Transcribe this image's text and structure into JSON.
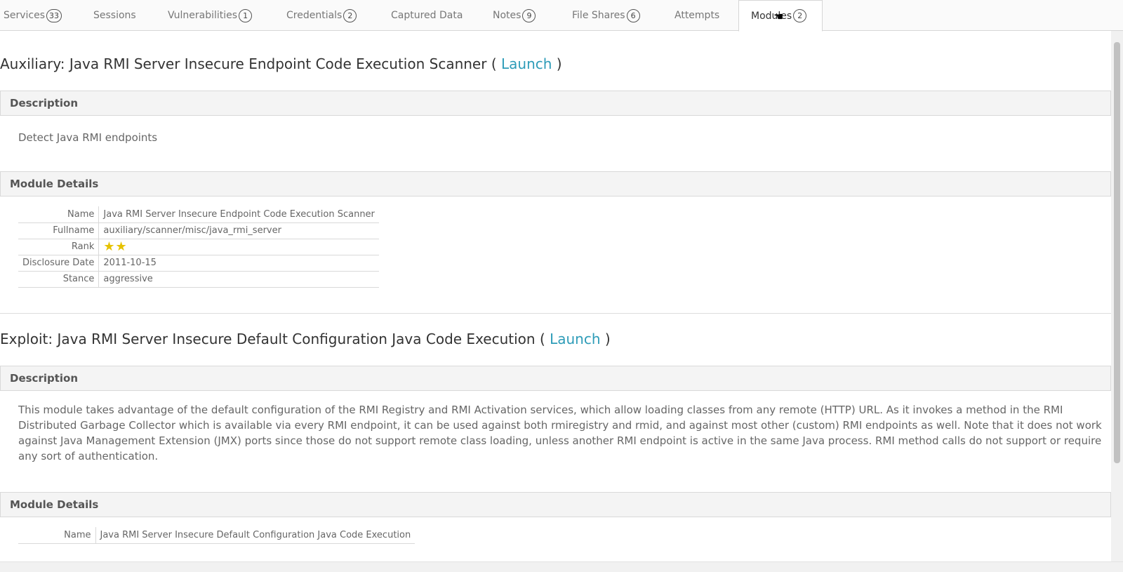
{
  "tabs": [
    {
      "label": "Services",
      "count": "33"
    },
    {
      "label": "Sessions",
      "count": null
    },
    {
      "label": "Vulnerabilities",
      "count": "1"
    },
    {
      "label": "Credentials",
      "count": "2"
    },
    {
      "label": "Captured Data",
      "count": null
    },
    {
      "label": "Notes",
      "count": "9"
    },
    {
      "label": "File Shares",
      "count": "6"
    },
    {
      "label": "Attempts",
      "count": null
    },
    {
      "label": "Modules",
      "count": "2"
    }
  ],
  "active_tab": "Modules",
  "modules": [
    {
      "type_prefix": "Auxiliary:",
      "title": "Java RMI Server Insecure Endpoint Code Execution Scanner",
      "open_paren": "(",
      "launch_label": "Launch",
      "close_paren": ")",
      "description_header": "Description",
      "description": "Detect Java RMI endpoints",
      "details_header": "Module Details",
      "details": [
        {
          "key": "Name",
          "value": "Java RMI Server Insecure Endpoint Code Execution Scanner"
        },
        {
          "key": "Fullname",
          "value": "auxiliary/scanner/misc/java_rmi_server"
        },
        {
          "key": "Rank",
          "value": "★★"
        },
        {
          "key": "Disclosure Date",
          "value": "2011-10-15"
        },
        {
          "key": "Stance",
          "value": "aggressive"
        }
      ]
    },
    {
      "type_prefix": "Exploit:",
      "title": "Java RMI Server Insecure Default Configuration Java Code Execution",
      "open_paren": "(",
      "launch_label": "Launch",
      "close_paren": ")",
      "description_header": "Description",
      "description": "This module takes advantage of the default configuration of the RMI Registry and RMI Activation services, which allow loading classes from any remote (HTTP) URL. As it invokes a method in the RMI Distributed Garbage Collector which is available via every RMI endpoint, it can be used against both rmiregistry and rmid, and against most other (custom) RMI endpoints as well. Note that it does not work against Java Management Extension (JMX) ports since those do not support remote class loading, unless another RMI endpoint is active in the same Java process. RMI method calls do not support or require any sort of authentication.",
      "details_header": "Module Details",
      "details": [
        {
          "key": "Name",
          "value": "Java RMI Server Insecure Default Configuration Java Code Execution"
        }
      ]
    }
  ],
  "colors": {
    "link": "#2e9cb8",
    "star": "#e6c200"
  },
  "icons": [
    "mouse-cursor-icon",
    "star-icon"
  ]
}
